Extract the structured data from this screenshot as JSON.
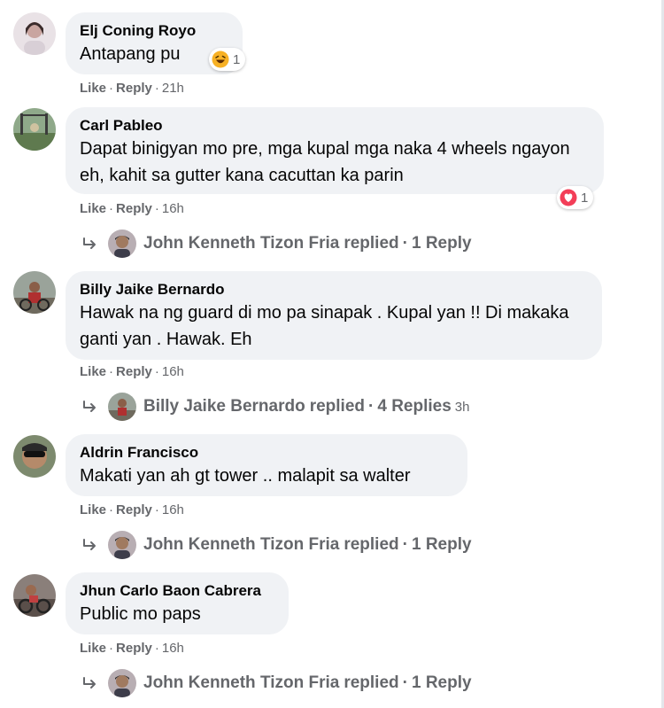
{
  "comments": [
    {
      "author": "Elj Coning Royo",
      "text": "Antapang pu",
      "like": "Like",
      "reply": "Reply",
      "time": "21h",
      "reaction": {
        "icon": "haha-icon",
        "count": "1"
      }
    },
    {
      "author": "Carl Pableo",
      "text": "Dapat binigyan mo pre, mga kupal mga naka 4 wheels ngayon eh, kahit sa gutter kana cacuttan ka parin",
      "like": "Like",
      "reply": "Reply",
      "time": "16h",
      "reaction": {
        "icon": "love-icon",
        "count": "1"
      },
      "replies": {
        "name": "John Kenneth Tizon Fria",
        "verb": "replied",
        "count": "1 Reply",
        "time": ""
      }
    },
    {
      "author": "Billy Jaike Bernardo",
      "text": "Hawak na ng guard di mo pa sinapak . Kupal yan !! Di makaka ganti yan . Hawak. Eh",
      "like": "Like",
      "reply": "Reply",
      "time": "16h",
      "replies": {
        "name": "Billy Jaike Bernardo",
        "verb": "replied",
        "count": "4 Replies",
        "time": "3h"
      }
    },
    {
      "author": "Aldrin Francisco",
      "text": "Makati yan ah gt tower .. malapit sa walter",
      "like": "Like",
      "reply": "Reply",
      "time": "16h",
      "replies": {
        "name": "John Kenneth Tizon Fria",
        "verb": "replied",
        "count": "1 Reply",
        "time": ""
      }
    },
    {
      "author": "Jhun Carlo Baon Cabrera",
      "text": "Public mo paps",
      "like": "Like",
      "reply": "Reply",
      "time": "16h",
      "replies": {
        "name": "John Kenneth Tizon Fria",
        "verb": "replied",
        "count": "1 Reply",
        "time": ""
      }
    }
  ],
  "colors": {
    "bubble": "#f0f2f5",
    "meta": "#65676b",
    "text": "#050505",
    "haha": "#f7b125",
    "love": "#f33e58"
  }
}
